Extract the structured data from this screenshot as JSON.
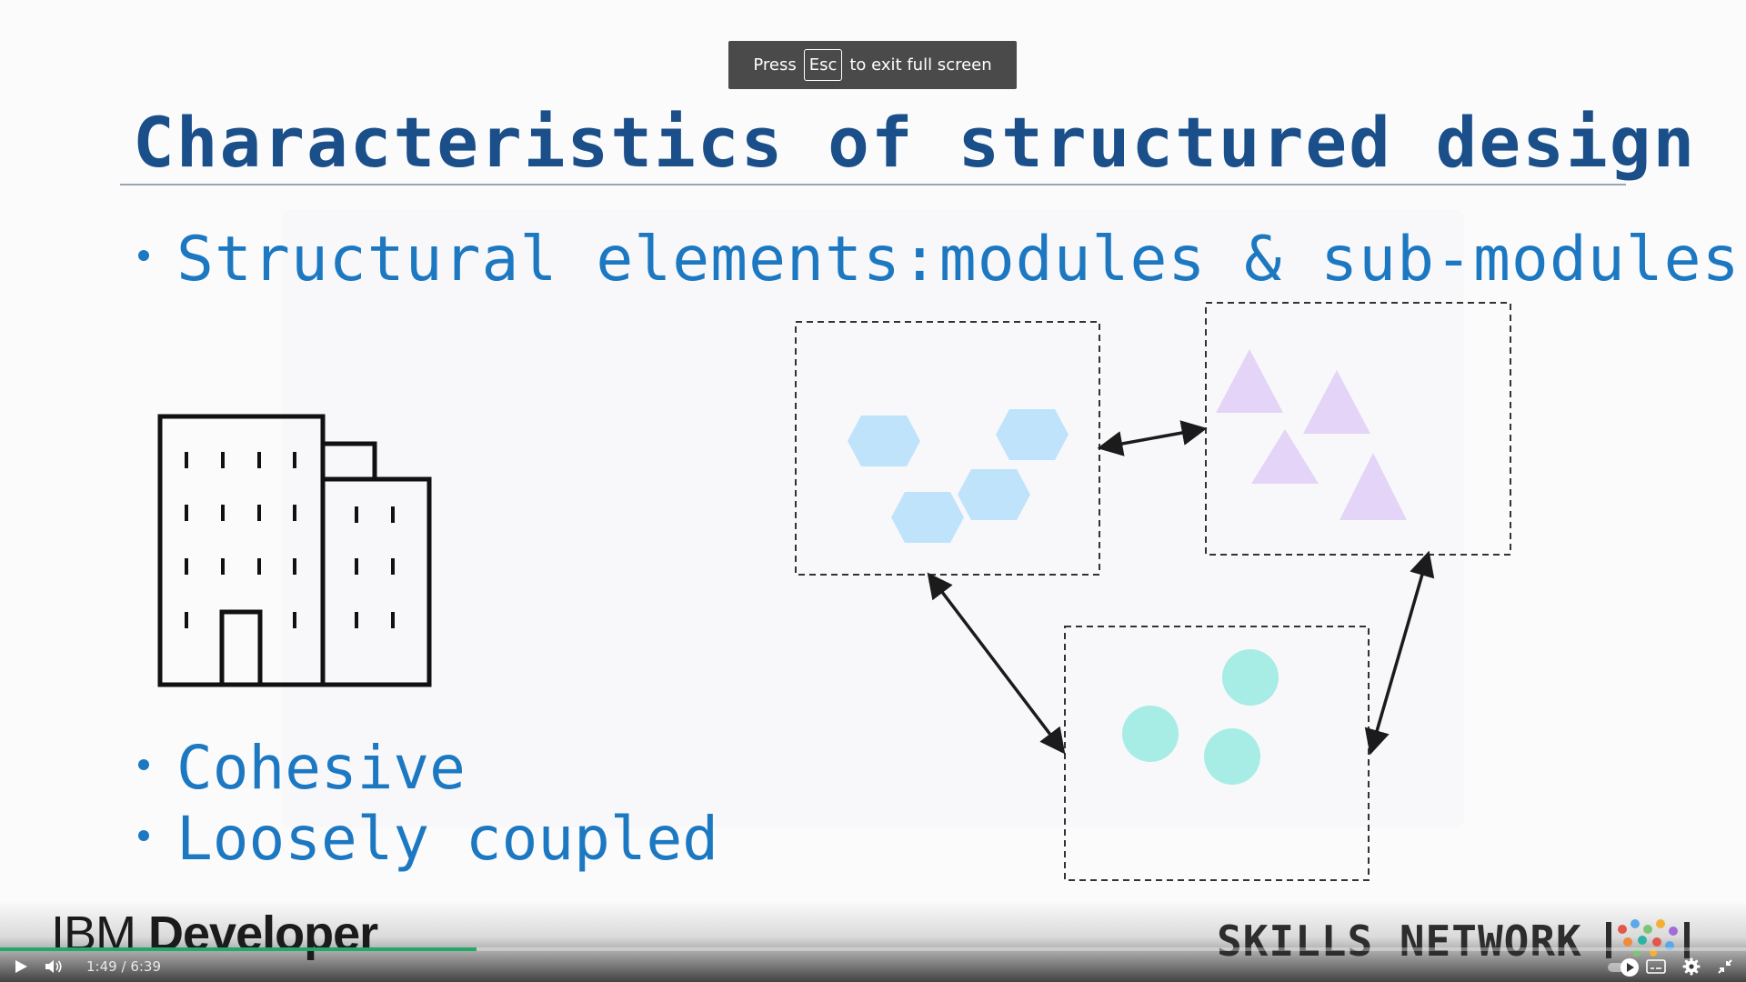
{
  "fullscreen_notice": {
    "prefix": "Press",
    "key": "Esc",
    "suffix": "to exit full screen"
  },
  "slide": {
    "title": "Characteristics of structured design",
    "bullets": [
      "Structural elements:modules & sub-modules",
      "Cohesive",
      "Loosely coupled"
    ]
  },
  "diagram": {
    "icons": [
      "building-icon",
      "hexagon-module",
      "triangle-module",
      "circle-module"
    ],
    "colors": {
      "hexagon": "#bfe3fb",
      "triangle": "#e4d4f7",
      "circle": "#a8ece6",
      "border": "#333333"
    }
  },
  "branding": {
    "left_prefix": "IBM",
    "left_suffix": "Developer",
    "right": "SKILLS NETWORK"
  },
  "player": {
    "current_time": "1:49",
    "separator": "/",
    "duration": "6:39",
    "progress_percent": 27.3,
    "colors": {
      "progress": "#23a86a"
    }
  }
}
